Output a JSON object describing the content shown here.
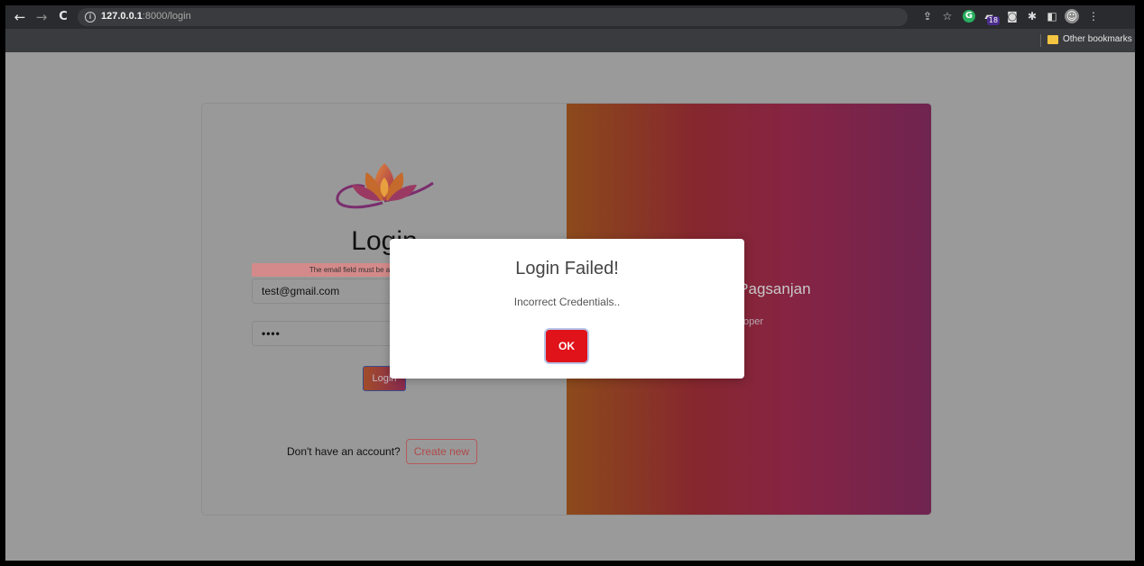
{
  "browser": {
    "nav": {
      "back": "←",
      "forward": "→",
      "reload": "C"
    },
    "url_host": "127.0.0.1",
    "url_path": ":8000/login",
    "toolbar_icons": [
      "share-icon",
      "star-icon",
      "grammarly-icon",
      "extension-badge-icon",
      "camera-icon",
      "puzzle-icon",
      "sidepanel-icon",
      "avatar-icon",
      "menu-icon"
    ],
    "badge_count": "18",
    "grammarly_letter": "G",
    "bookmarks": {
      "other_label": "Other bookmarks"
    }
  },
  "login": {
    "title": "Login",
    "error_message": "The email field must be a valid email address.",
    "email_value": "test@gmail.com",
    "password_value": "••••",
    "submit_label": "Login",
    "signup_prompt": "Don't have an account?",
    "create_label": "Create new"
  },
  "profile": {
    "name": "e Pagsanjan",
    "role": "oper"
  },
  "modal": {
    "title": "Login Failed!",
    "message": "Incorrect Credentials..",
    "ok_label": "OK"
  },
  "colors": {
    "ok_button": "#e0121a",
    "gradient_start": "#8c4a1b",
    "gradient_end": "#6f2450"
  }
}
